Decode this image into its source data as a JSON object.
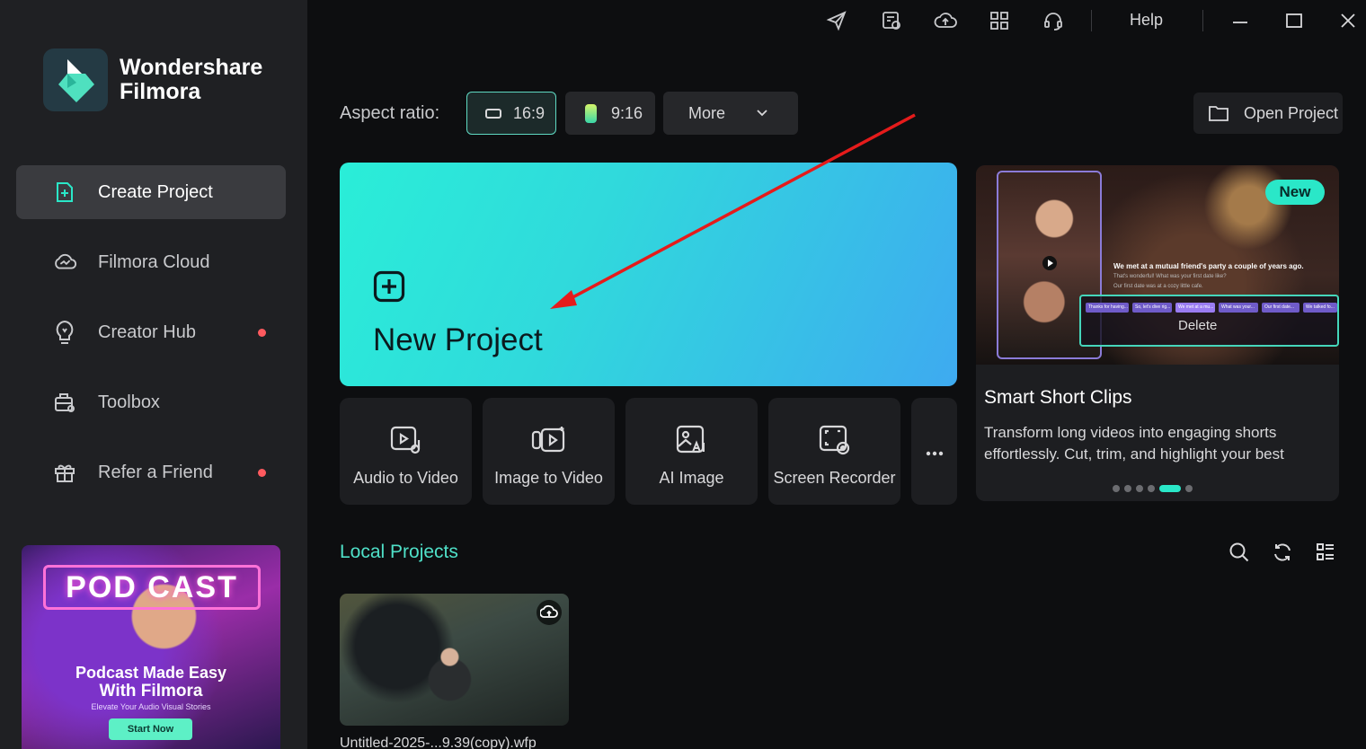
{
  "brand": {
    "line1": "Wondershare",
    "line2": "Filmora"
  },
  "sidebar": {
    "items": [
      {
        "label": "Create Project",
        "icon": "create-project-icon",
        "active": true,
        "dot": false
      },
      {
        "label": "Filmora Cloud",
        "icon": "cloud-icon",
        "active": false,
        "dot": false
      },
      {
        "label": "Creator Hub",
        "icon": "lightbulb-icon",
        "active": false,
        "dot": true
      },
      {
        "label": "Toolbox",
        "icon": "toolbox-icon",
        "active": false,
        "dot": false
      },
      {
        "label": "Refer a Friend",
        "icon": "gift-icon",
        "active": false,
        "dot": true
      }
    ],
    "promo": {
      "headline": "POD CAST",
      "line1": "Podcast Made Easy",
      "line2": "With Filmora",
      "line3": "Elevate Your Audio Visual Stories",
      "cta": "Start Now"
    }
  },
  "topbar": {
    "help": "Help"
  },
  "aspect": {
    "label": "Aspect ratio:",
    "opt1": "16:9",
    "opt2": "9:16",
    "more": "More"
  },
  "open_project": "Open Project",
  "new_project": {
    "title": "New Project"
  },
  "tools": [
    {
      "label": "Audio to Video"
    },
    {
      "label": "Image to Video"
    },
    {
      "label": "AI Image"
    },
    {
      "label": "Screen Recorder"
    }
  ],
  "feature": {
    "badge": "New",
    "title": "Smart Short Clips",
    "desc": "Transform long videos into engaging shorts effortlessly. Cut, trim, and highlight your best",
    "caption1": "We met at a mutual friend's party a couple of years ago.",
    "caption2": "That's wonderful! What was your first date like?",
    "caption3": "Our first date was at a cozy little cafe.",
    "chips": [
      "Thanks for having...",
      "So, let's dive rig...",
      "We met at a mu...",
      "What was your...",
      "Our first date...",
      "We talked fo..."
    ],
    "overlay": "Delete"
  },
  "local": {
    "title": "Local Projects",
    "project_name": "Untitled-2025-...9.39(copy).wfp"
  },
  "colors": {
    "accent": "#2ae7c8",
    "notify": "#ff5a5f",
    "sidebar_bg": "#1f2023",
    "app_bg": "#0d0e10"
  }
}
